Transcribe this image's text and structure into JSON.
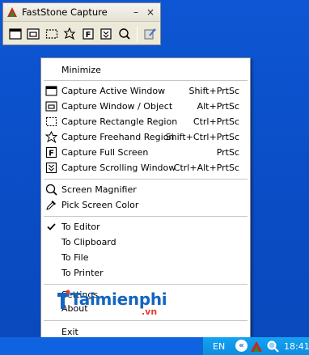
{
  "app": {
    "title": "FastStone Capture",
    "minimize_glyph": "–",
    "close_glyph": "×"
  },
  "toolbar": {
    "buttons": [
      {
        "icon": "active-window-icon"
      },
      {
        "icon": "window-object-icon"
      },
      {
        "icon": "rectangle-region-icon"
      },
      {
        "icon": "freehand-region-icon"
      },
      {
        "icon": "full-screen-icon"
      },
      {
        "icon": "scrolling-window-icon"
      },
      {
        "icon": "magnifier-icon"
      },
      {
        "icon": "settings-icon"
      }
    ]
  },
  "menu": {
    "minimize": "Minimize",
    "capture": [
      {
        "label": "Capture Active Window",
        "shortcut": "Shift+PrtSc",
        "icon": "active-window-icon"
      },
      {
        "label": "Capture Window / Object",
        "shortcut": "Alt+PrtSc",
        "icon": "window-object-icon"
      },
      {
        "label": "Capture Rectangle Region",
        "shortcut": "Ctrl+PrtSc",
        "icon": "rectangle-region-icon"
      },
      {
        "label": "Capture Freehand Region",
        "shortcut": "Shift+Ctrl+PrtSc",
        "icon": "freehand-region-icon"
      },
      {
        "label": "Capture Full Screen",
        "shortcut": "PrtSc",
        "icon": "full-screen-icon"
      },
      {
        "label": "Capture Scrolling Window",
        "shortcut": "Ctrl+Alt+PrtSc",
        "icon": "scrolling-window-icon"
      }
    ],
    "tools": [
      {
        "label": "Screen Magnifier",
        "icon": "magnifier-icon"
      },
      {
        "label": "Pick Screen Color",
        "icon": "eyedropper-icon"
      }
    ],
    "outputs": [
      {
        "label": "To Editor",
        "checked": true
      },
      {
        "label": "To Clipboard",
        "checked": false
      },
      {
        "label": "To File",
        "checked": false
      },
      {
        "label": "To Printer",
        "checked": false
      }
    ],
    "settings": "Settings",
    "about": "About",
    "exit": "Exit"
  },
  "watermark": {
    "text": "Taimienphi",
    "suffix": ".vn"
  },
  "tray": {
    "language": "EN",
    "chevron": "«",
    "clock": "18:41"
  },
  "colors": {
    "desktop": "#0b52cc",
    "menu_bg": "#ffffff",
    "tray_bg": "#0d8de0"
  }
}
